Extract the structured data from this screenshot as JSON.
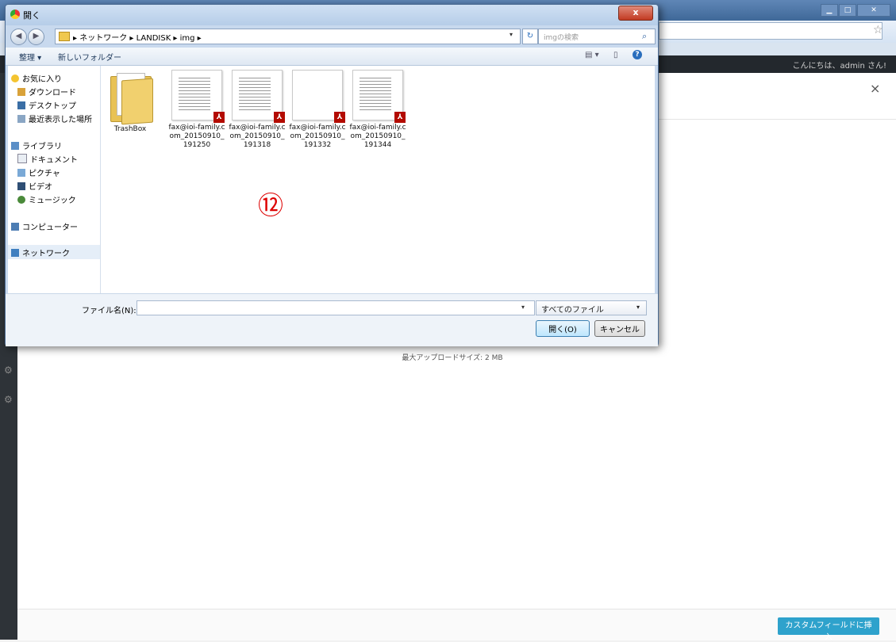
{
  "browser": {
    "admin_greeting": "こんにちは、admin さん!",
    "close_glyph": "×",
    "max_upload": "最大アップロードサイズ: 2 MB",
    "insert_button": "カスタムフィールドに挿入",
    "win_min": "▁",
    "win_max": "□",
    "win_close": "✕",
    "star": "☆",
    "gear": "⚙"
  },
  "dialog": {
    "title": "開く",
    "close_glyph": "x",
    "back_glyph": "◀",
    "forward_glyph": "▶",
    "breadcrumb": "▸ ネットワーク ▸ LANDISK ▸ img ▸",
    "breadcrumb_drop": "▾",
    "refresh_glyph": "↻",
    "search_placeholder": "imgの検索",
    "search_icon": "⌕",
    "toolbar": {
      "organize": "整理 ▾",
      "new_folder": "新しいフォルダー",
      "view": "▤ ▾",
      "pane": "▯",
      "help": "?"
    },
    "nav": {
      "favorites": "お気に入り",
      "downloads": "ダウンロード",
      "desktop": "デスクトップ",
      "recent": "最近表示した場所",
      "libraries": "ライブラリ",
      "documents": "ドキュメント",
      "pictures": "ピクチャ",
      "videos": "ビデオ",
      "music": "ミュージック",
      "computer": "コンピューター",
      "network": "ネットワーク"
    },
    "files": [
      {
        "name": "TrashBox"
      },
      {
        "name": "fax@ioi-family.com_20150910_191250",
        "badge": "⅄"
      },
      {
        "name": "fax@ioi-family.com_20150910_191318",
        "badge": "⅄"
      },
      {
        "name": "fax@ioi-family.com_20150910_191332",
        "badge": "⅄"
      },
      {
        "name": "fax@ioi-family.com_20150910_191344",
        "badge": "⅄"
      }
    ],
    "annotation": "⑫",
    "filename_label": "ファイル名(N):",
    "filename_value": "",
    "filename_drop": "▾",
    "filetype": "すべてのファイル",
    "filetype_arrow": "▾",
    "open_button": "開く(O)",
    "cancel_button": "キャンセル"
  },
  "colors": {
    "accent": "#2ea2cc",
    "annotation": "#dd0000"
  }
}
